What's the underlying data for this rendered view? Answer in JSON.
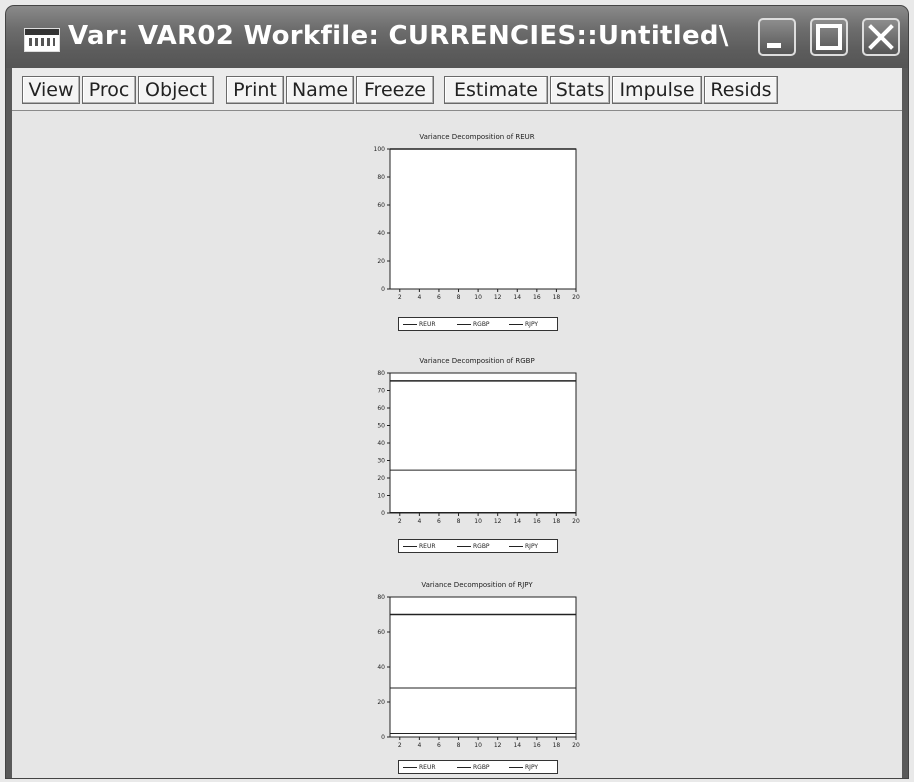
{
  "window": {
    "title": "Var: VAR02   Workfile: CURRENCIES::Untitled\\",
    "buttons": [
      "minimize",
      "maximize",
      "close"
    ]
  },
  "toolbar": {
    "buttons": [
      "View",
      "Proc",
      "Object",
      "Print",
      "Name",
      "Freeze",
      "Estimate",
      "Stats",
      "Impulse",
      "Resids"
    ]
  },
  "chart_data": [
    {
      "type": "line",
      "title": "Variance Decomposition of REUR",
      "x": [
        2,
        4,
        6,
        8,
        10,
        12,
        14,
        16,
        18,
        20
      ],
      "ylim": [
        0,
        100
      ],
      "yticks": [
        0,
        20,
        40,
        60,
        80,
        100
      ],
      "series": [
        {
          "name": "REUR",
          "values": [
            100,
            100,
            100,
            100,
            100,
            100,
            100,
            100,
            100,
            100
          ]
        },
        {
          "name": "RGBP",
          "values": [
            0,
            0,
            0,
            0,
            0,
            0,
            0,
            0,
            0,
            0
          ]
        },
        {
          "name": "RJPY",
          "values": [
            0,
            0,
            0,
            0,
            0,
            0,
            0,
            0,
            0,
            0
          ]
        }
      ],
      "legend": "bottom"
    },
    {
      "type": "line",
      "title": "Variance Decomposition of RGBP",
      "x": [
        2,
        4,
        6,
        8,
        10,
        12,
        14,
        16,
        18,
        20
      ],
      "ylim": [
        0,
        80
      ],
      "yticks": [
        0,
        10,
        20,
        30,
        40,
        50,
        60,
        70,
        80
      ],
      "series": [
        {
          "name": "REUR",
          "values": [
            75.5,
            75.5,
            75.5,
            75.5,
            75.5,
            75.5,
            75.5,
            75.5,
            75.5,
            75.5
          ]
        },
        {
          "name": "RGBP",
          "values": [
            24.5,
            24.5,
            24.5,
            24.5,
            24.5,
            24.5,
            24.5,
            24.5,
            24.5,
            24.5
          ]
        },
        {
          "name": "RJPY",
          "values": [
            0.3,
            0.3,
            0.3,
            0.3,
            0.3,
            0.3,
            0.3,
            0.3,
            0.3,
            0.3
          ]
        }
      ],
      "legend": "bottom"
    },
    {
      "type": "line",
      "title": "Variance Decomposition of RJPY",
      "x": [
        2,
        4,
        6,
        8,
        10,
        12,
        14,
        16,
        18,
        20
      ],
      "ylim": [
        0,
        80
      ],
      "yticks": [
        0,
        20,
        40,
        60,
        80
      ],
      "series": [
        {
          "name": "REUR",
          "values": [
            70,
            70,
            70,
            70,
            70,
            70,
            70,
            70,
            70,
            70
          ]
        },
        {
          "name": "RGBP",
          "values": [
            28,
            28,
            28,
            28,
            28,
            28,
            28,
            28,
            28,
            28
          ]
        },
        {
          "name": "RJPY",
          "values": [
            2,
            2,
            2,
            2,
            2,
            2,
            2,
            2,
            2,
            2
          ]
        }
      ],
      "legend": "bottom"
    }
  ]
}
